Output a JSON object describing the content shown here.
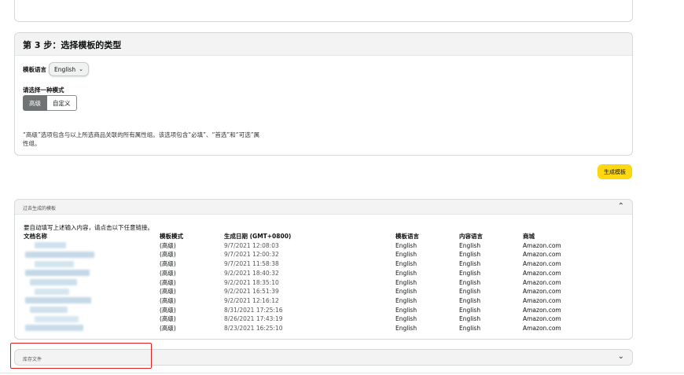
{
  "step3": {
    "title": "第 3 步：选择模板的类型",
    "template_language_label": "模板语言",
    "template_language_value": "English",
    "mode_prompt": "请选择一种模式",
    "modes": [
      "高级",
      "自定义"
    ],
    "selected_mode": "高级",
    "description_line1": "“高级”选项包含与以上所选商品关联的所有属性组。该选项包含“必填”、“首选”和“可选”属",
    "description_line2": "性组。"
  },
  "generate_button": "生成模板",
  "past_templates": {
    "title": "过去生成的模板",
    "hint": "要自动填写上述输入内容，请点击以下任意链接。",
    "columns": {
      "name": "文档名称",
      "mode": "模板模式",
      "date": "生成日期 (GMT+0800)",
      "template_language": "模板语言",
      "content_language": "内容语言",
      "store": "商城"
    },
    "rows": [
      {
        "mode": "(高级)",
        "date": "9/7/2021 12:08:03",
        "template_language": "English",
        "content_language": "English",
        "store": "Amazon.com"
      },
      {
        "mode": "(高级)",
        "date": "9/7/2021 12:00:32",
        "template_language": "English",
        "content_language": "English",
        "store": "Amazon.com"
      },
      {
        "mode": "(高级)",
        "date": "9/7/2021 11:58:38",
        "template_language": "English",
        "content_language": "English",
        "store": "Amazon.com"
      },
      {
        "mode": "(高级)",
        "date": "9/2/2021 18:40:32",
        "template_language": "English",
        "content_language": "English",
        "store": "Amazon.com"
      },
      {
        "mode": "(高级)",
        "date": "9/2/2021 18:35:10",
        "template_language": "English",
        "content_language": "English",
        "store": "Amazon.com"
      },
      {
        "mode": "(高级)",
        "date": "9/2/2021 16:51:39",
        "template_language": "English",
        "content_language": "English",
        "store": "Amazon.com"
      },
      {
        "mode": "(高级)",
        "date": "9/2/2021 12:16:12",
        "template_language": "English",
        "content_language": "English",
        "store": "Amazon.com"
      },
      {
        "mode": "(高级)",
        "date": "8/31/2021 17:25:16",
        "template_language": "English",
        "content_language": "English",
        "store": "Amazon.com"
      },
      {
        "mode": "(高级)",
        "date": "8/26/2021 17:43:19",
        "template_language": "English",
        "content_language": "English",
        "store": "Amazon.com"
      },
      {
        "mode": "(高级)",
        "date": "8/23/2021 16:25:10",
        "template_language": "English",
        "content_language": "English",
        "store": "Amazon.com"
      }
    ]
  },
  "inventory_files": {
    "title": "库存文件"
  },
  "colors": {
    "accent_button": "#ffd814",
    "highlight": "#e0201c",
    "mode_active": "#6f7373"
  }
}
